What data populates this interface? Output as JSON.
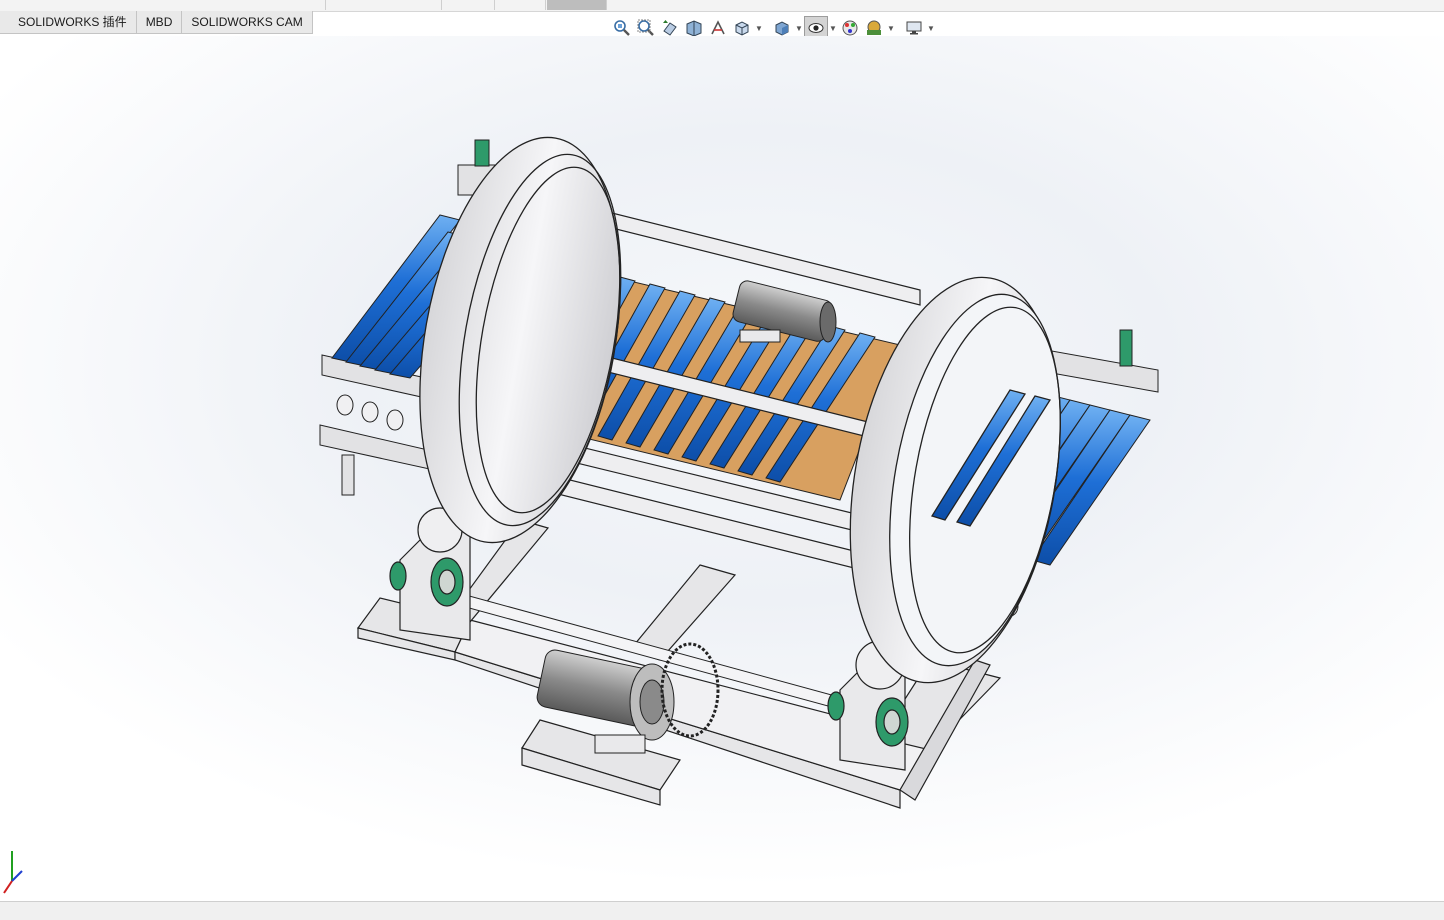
{
  "tabs": [
    {
      "label": "SOLIDWORKS 插件"
    },
    {
      "label": "MBD"
    },
    {
      "label": "SOLIDWORKS CAM"
    }
  ],
  "view_toolbar": {
    "icons": [
      "zoom-to-fit-icon",
      "zoom-to-area-icon",
      "previous-view-icon",
      "section-view-icon",
      "dynamic-annotation-icon",
      "view-orientation-icon",
      "display-style-icon",
      "hide-show-items-icon",
      "edit-appearance-icon",
      "apply-scene-icon",
      "view-settings-icon"
    ]
  },
  "model": {
    "name": "rotary roller conveyor turnover machine",
    "colors": {
      "frame": "#e4e4e6",
      "ring": "#efeff1",
      "roller": "#1e6fd6",
      "roller_highlight": "#6fb0f2",
      "plate": "#d8a060",
      "bearing": "#2e9a6a",
      "motor": "#8a8a8a",
      "outline": "#222222"
    }
  },
  "triad": {
    "x_color": "#d02020",
    "y_color": "#20a020",
    "z_color": "#2040d0"
  }
}
